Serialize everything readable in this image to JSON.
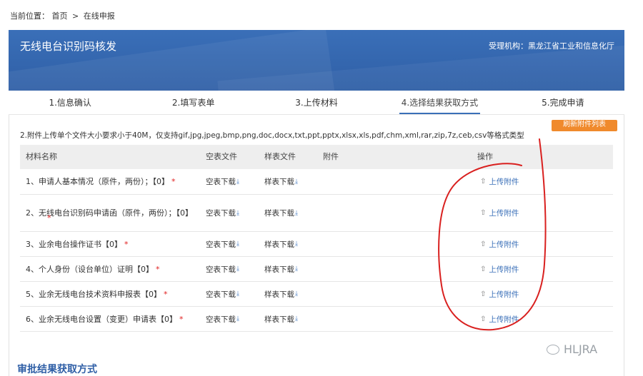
{
  "breadcrumb": {
    "prefix": "当前位置：",
    "home": "首页",
    "sep": ">",
    "current": "在线申报"
  },
  "header": {
    "title": "无线电台识别码核发",
    "org": "受理机构：黑龙江省工业和信息化厅"
  },
  "steps": [
    {
      "label": "1.信息确认"
    },
    {
      "label": "2.填写表单"
    },
    {
      "label": "3.上传材料"
    },
    {
      "label": "4.选择结果获取方式"
    },
    {
      "label": "5.完成申请"
    }
  ],
  "refresh_button": "刷新附件列表",
  "notice": "2.附件上传单个文件大小要求小于40M，仅支持gif,jpg,jpeg,bmp,png,doc,docx,txt,ppt,pptx,xlsx,xls,pdf,chm,xml,rar,zip,7z,ceb,csv等格式类型",
  "table": {
    "headers": {
      "name": "材料名称",
      "empty": "空表文件",
      "sample": "样表文件",
      "attachment": "附件",
      "operation": "操作"
    },
    "empty_download": "空表下载",
    "sample_download": "样表下载",
    "upload": "上传附件",
    "required_mark": "*",
    "rows": [
      {
        "name": "1、申请人基本情况（原件，两份）；【0】"
      },
      {
        "name": "2、无线电台识别码申请函（原件，两份）；【0】"
      },
      {
        "name": "3、业余电台操作证书【0】"
      },
      {
        "name": "4、个人身份（设台单位）证明【0】"
      },
      {
        "name": "5、业余无线电台技术资料申报表【0】"
      },
      {
        "name": "6、业余无线电台设置（变更）申请表【0】"
      }
    ]
  },
  "section_title": "审批结果获取方式",
  "watermark": "HLJRA",
  "colors": {
    "header_blue": "#3a6fb8",
    "accent_orange": "#f08a2c",
    "required_red": "#e02020",
    "annotation_red": "#d9201f"
  },
  "icons": {
    "download": "download-icon",
    "upload": "upload-icon",
    "watermark": "wechat-icon"
  }
}
